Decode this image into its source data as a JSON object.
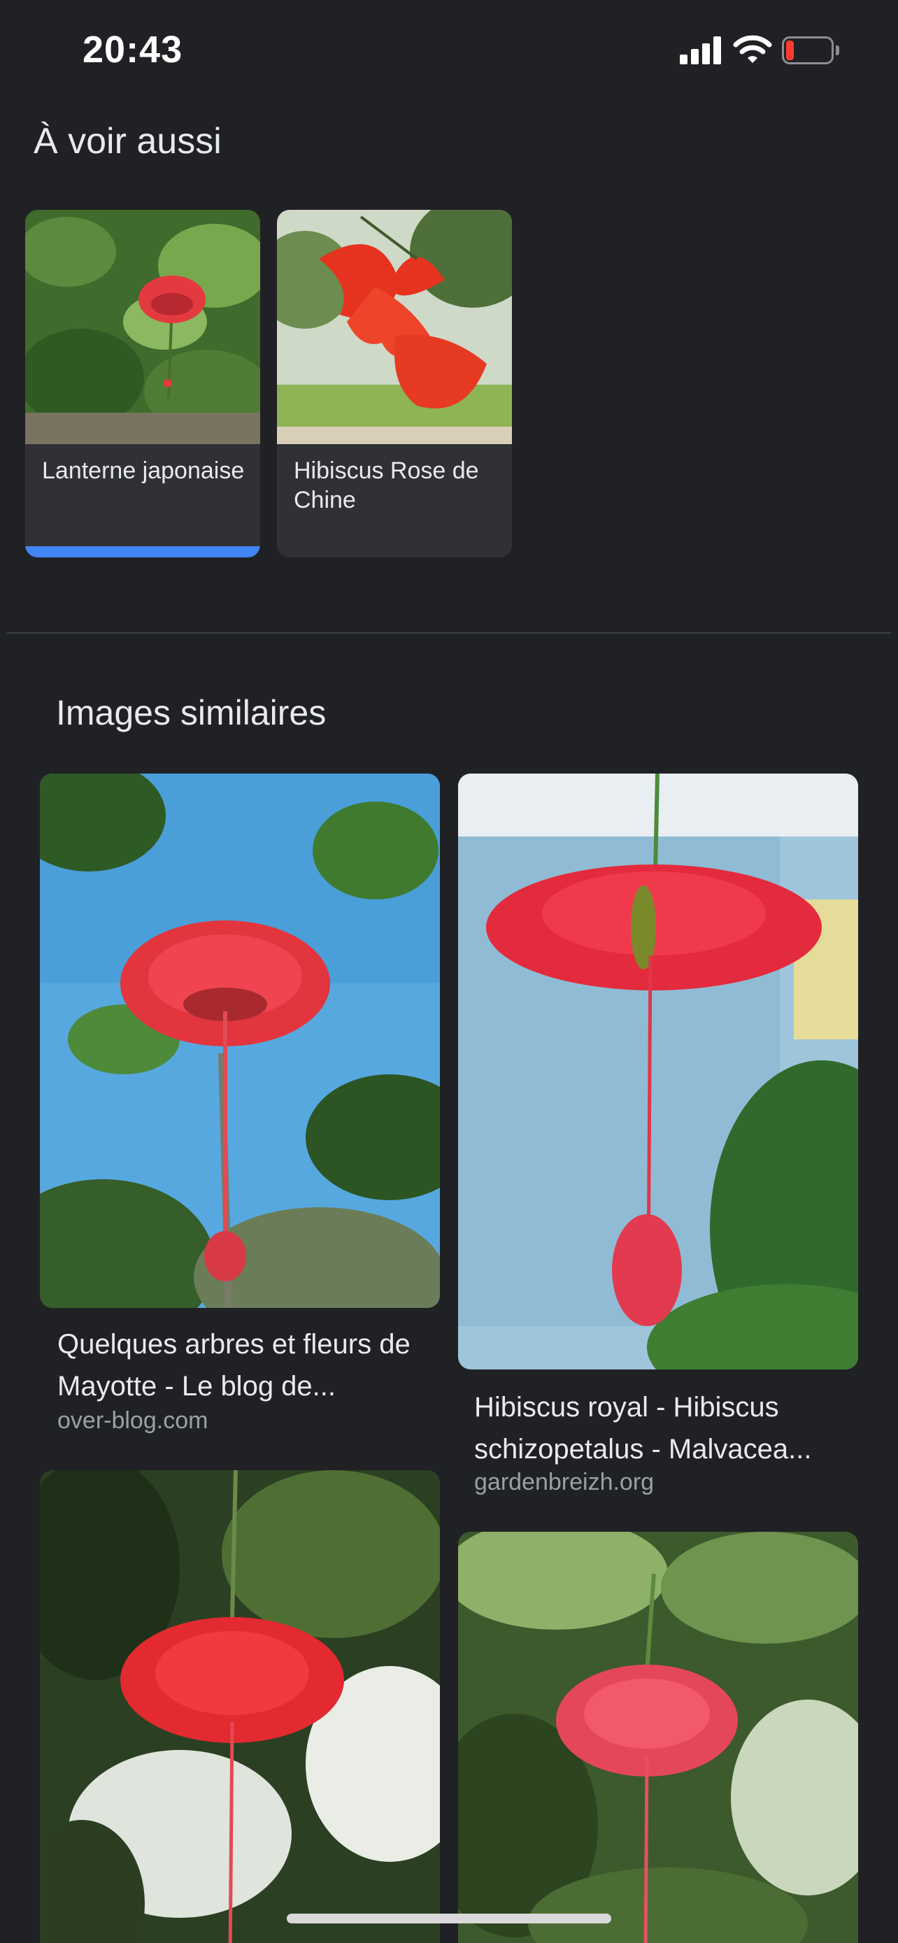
{
  "status_bar": {
    "time": "20:43",
    "battery_color": "#ff3b30"
  },
  "see_also": {
    "title": "À voir aussi",
    "items": [
      {
        "label": "Lanterne japonaise",
        "selected": true
      },
      {
        "label": "Hibiscus Rose de Chine",
        "selected": false
      }
    ]
  },
  "similar_images": {
    "title": "Images similaires",
    "results": [
      {
        "title": "Quelques arbres et fleurs de Mayotte - Le blog de...",
        "source": "over-blog.com"
      },
      {
        "title": "Hibiscus royal - Hibiscus schizopetalus - Malvacea...",
        "source": "gardenbreizh.org"
      }
    ]
  },
  "colors": {
    "background": "#202124",
    "card": "#303134",
    "accent": "#4285f4",
    "flower": "#e8363f"
  }
}
